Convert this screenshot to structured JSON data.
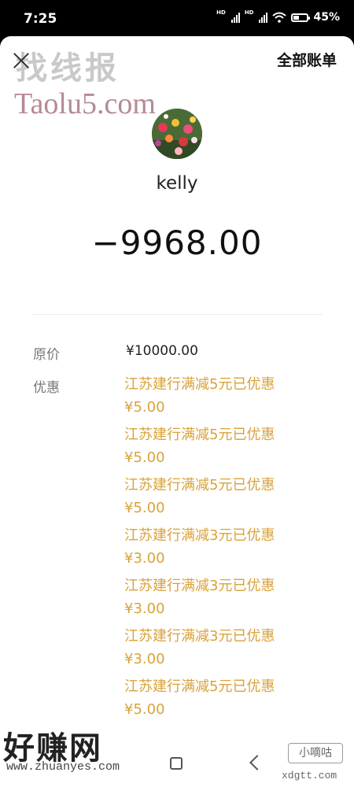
{
  "status_bar": {
    "time": "7:25",
    "battery": "45%",
    "battery_level": 0.45
  },
  "header": {
    "all_bills": "全部账单"
  },
  "watermarks": {
    "top_cn": "找线报",
    "top_en": "Taolu5.com",
    "bottom_left_cn": "好赚网",
    "bottom_left_en": "www.zhuanyes.com",
    "bottom_right_cn": "小嘀咕",
    "bottom_right_en": "xdgtt.com"
  },
  "payee": {
    "name": "kelly"
  },
  "amount": "−9968.00",
  "details": {
    "original_label": "原价",
    "original_value": "¥10000.00",
    "discount_label": "优惠",
    "discounts": [
      {
        "title": "江苏建行满减5元已优惠",
        "amount": "¥5.00"
      },
      {
        "title": "江苏建行满减5元已优惠",
        "amount": "¥5.00"
      },
      {
        "title": "江苏建行满减5元已优惠",
        "amount": "¥5.00"
      },
      {
        "title": "江苏建行满减3元已优惠",
        "amount": "¥3.00"
      },
      {
        "title": "江苏建行满减3元已优惠",
        "amount": "¥3.00"
      },
      {
        "title": "江苏建行满减3元已优惠",
        "amount": "¥3.00"
      },
      {
        "title": "江苏建行满减5元已优惠",
        "amount": "¥5.00"
      }
    ]
  }
}
